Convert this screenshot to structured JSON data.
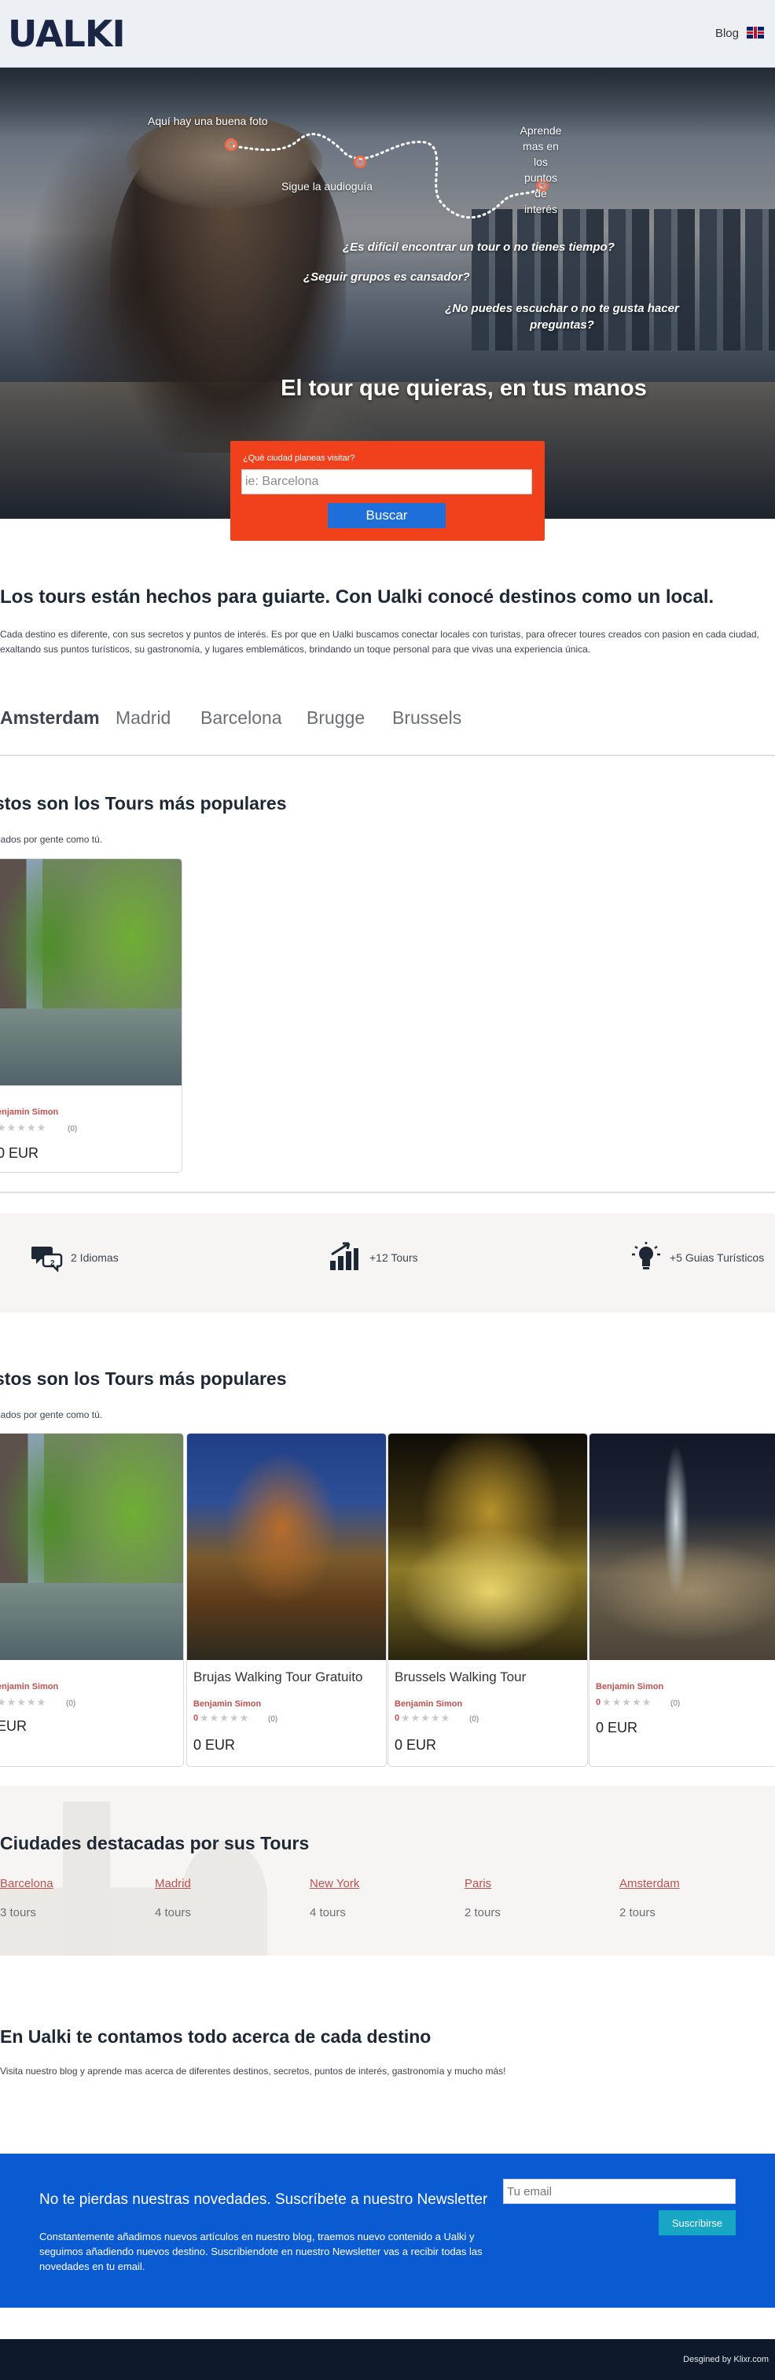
{
  "header": {
    "logo": "UALKI",
    "blog_link": "Blog"
  },
  "hero": {
    "labels": {
      "photo": "Aquí hay una buena foto",
      "audio": "Sigue la audioguía",
      "learn": "Aprende\nmas en\nlos\npuntos\nde\ninterés"
    },
    "questions": [
      "¿Es difícil encontrar un tour o no tienes tiempo?",
      "¿Seguir grupos es cansador?",
      "¿No puedes escuchar o no te gusta hacer preguntas?"
    ],
    "title": "El tour que quieras, en tus manos",
    "search": {
      "label": "¿Qué ciudad planeas visitar?",
      "placeholder": "ie: Barcelona",
      "button": "Buscar"
    }
  },
  "intro": {
    "title": "Los tours están hechos para guiarte. Con Ualki conocé destinos como un local.",
    "text": "Cada destino es diferente, con sus secretos y puntos de interés. Es por que en Ualki buscamos conectar locales con turistas, para ofrecer toures creados con pasion en cada ciudad, exaltando sus puntos turísticos, su gastronomía, y lugares emblemáticos, brindando un toque personal para que vivas una experiencia única."
  },
  "city_tabs": [
    "Amsterdam",
    "Madrid",
    "Barcelona",
    "Brugge",
    "Brussels"
  ],
  "popular1": {
    "title": "stos son los Tours más populares",
    "subtitle": "eados por gente como tú.",
    "cards": [
      {
        "guide": "enjamin Simon",
        "stars": "★★★★★",
        "reviews": "(0)",
        "price": "0 EUR"
      }
    ]
  },
  "stats": {
    "languages": "2 Idiomas",
    "tours": "+12 Tours",
    "guides": "+5 Guias Turísticos"
  },
  "popular2": {
    "title": "stos son los Tours más populares",
    "subtitle": "eados por gente como tú.",
    "cards": [
      {
        "title": "",
        "guide": "enjamin Simon",
        "stars": "★★★★★",
        "reviews": "(0)",
        "price": " EUR"
      },
      {
        "title": "Brujas Walking Tour Gratuito",
        "guide": "Benjamin Simon",
        "rating": "0",
        "stars": "★★★★★",
        "reviews": "(0)",
        "price": "0 EUR"
      },
      {
        "title": "Brussels Walking Tour",
        "guide": "Benjamin Simon",
        "rating": "0",
        "stars": "★★★★★",
        "reviews": "(0)",
        "price": "0 EUR"
      },
      {
        "title": "",
        "guide": "Benjamin Simon",
        "rating": "0",
        "stars": "★★★★★",
        "reviews": "(0)",
        "price": "0 EUR"
      }
    ]
  },
  "cities": {
    "title": "Ciudades destacadas por sus Tours",
    "items": [
      {
        "name": "Barcelona",
        "count": "3 tours"
      },
      {
        "name": "Madrid",
        "count": "4 tours"
      },
      {
        "name": "New York",
        "count": "4 tours"
      },
      {
        "name": "Paris",
        "count": "2 tours"
      },
      {
        "name": "Amsterdam",
        "count": "2 tours"
      }
    ]
  },
  "blog": {
    "title": "En Ualki te contamos todo acerca de cada destino",
    "text": "Visita nuestro blog y aprende mas acerca de diferentes destinos, secretos, puntos de interés, gastronomía y mucho más!"
  },
  "newsletter": {
    "title": "No te pierdas nuestras novedades. Suscríbete a nuestro Newsletter",
    "text": "Constantemente añadimos nuevos artículos en nuestro blog, traemos nuevo contenido a Ualki y seguimos añadiendo nuevos destino. Suscribiendote en nuestro Newsletter vas a recibir todas las novedades en tu email.",
    "placeholder": "Tu email",
    "button": "Suscribirse"
  },
  "footer": {
    "text": "Desgined by Klixr.com"
  },
  "colors": {
    "brand": "#1b2545",
    "search_box": "#f0411c",
    "primary_button": "#1e6fd9",
    "newsletter_bg": "#0a5bd1",
    "guide_link": "#c0504d",
    "footer_bg": "#0e1a2b"
  }
}
